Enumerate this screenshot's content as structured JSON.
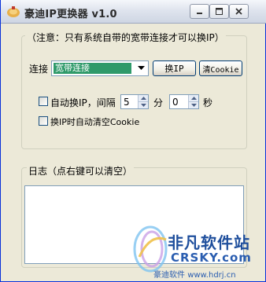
{
  "window": {
    "title": "豪迪IP更换器 v1.0",
    "controls": {
      "minimize": "minimize",
      "maximize": "maximize",
      "close": "close"
    }
  },
  "settings_group": {
    "legend": "（注意：只有系统自带的宽带连接才可以换IP）",
    "connection_label": "连接",
    "connection_selected": "宽带连接",
    "change_ip_button": "换IP",
    "clear_cookie_button": "清Cookie",
    "auto_change_label": "自动换IP，间隔",
    "interval_minutes": "5",
    "minutes_unit": "分",
    "interval_seconds": "0",
    "seconds_unit": "秒",
    "auto_clear_cookie_label": "换IP时自动清空Cookie",
    "auto_change_checked": false,
    "auto_clear_checked": false
  },
  "log_group": {
    "legend": "日志（点右键可以清空）",
    "content": ""
  },
  "footer": {
    "text": "豪迪软件"
  },
  "watermark": {
    "cn": "非凡软件站",
    "en": "CRSKY.com",
    "url": "www.hdrj.cn"
  },
  "colors": {
    "selection": "#2f9a6a",
    "titlebar": "#dfe4ee",
    "background": "#ece9d8"
  }
}
